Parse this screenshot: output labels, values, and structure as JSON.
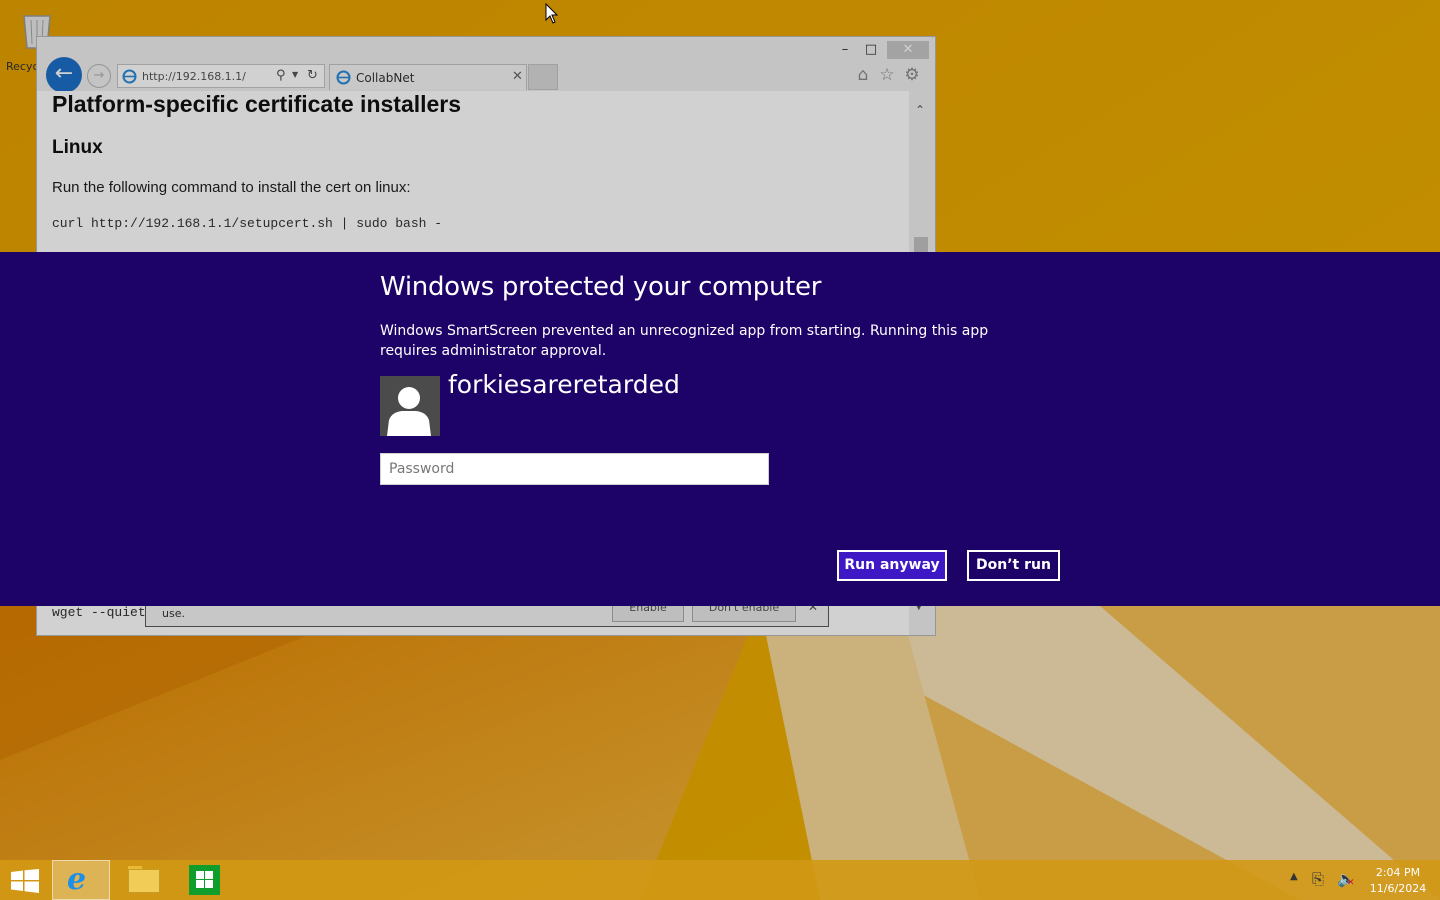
{
  "desktop": {
    "recycle_bin_label": "Recyc"
  },
  "browser": {
    "url": "http://192.168.1.1/",
    "tab_title": "CollabNet",
    "page": {
      "heading": "Platform-specific certificate installers",
      "subheading": "Linux",
      "text": "Run the following command to install the cert on linux:",
      "command": "curl http://192.168.1.1/setupcert.sh | sudo bash -",
      "command_bottom": "wget --quiet"
    },
    "notification": {
      "text": "use.",
      "enable_label": "Enable",
      "disable_label": "Don't enable"
    }
  },
  "smartscreen": {
    "title": "Windows protected your computer",
    "message": "Windows SmartScreen prevented an unrecognized app from starting. Running this app requires administrator approval.",
    "username": "forkiesareretarded",
    "password_placeholder": "Password",
    "run_anyway_label": "Run anyway",
    "dont_run_label": "Don’t run",
    "band_color": "#1d0268",
    "accent_color": "#3f18c6"
  },
  "taskbar": {
    "pinned": [
      "internet-explorer",
      "file-explorer",
      "windows-store"
    ],
    "clock_time": "2:04 PM",
    "clock_date": "11/6/2024"
  }
}
